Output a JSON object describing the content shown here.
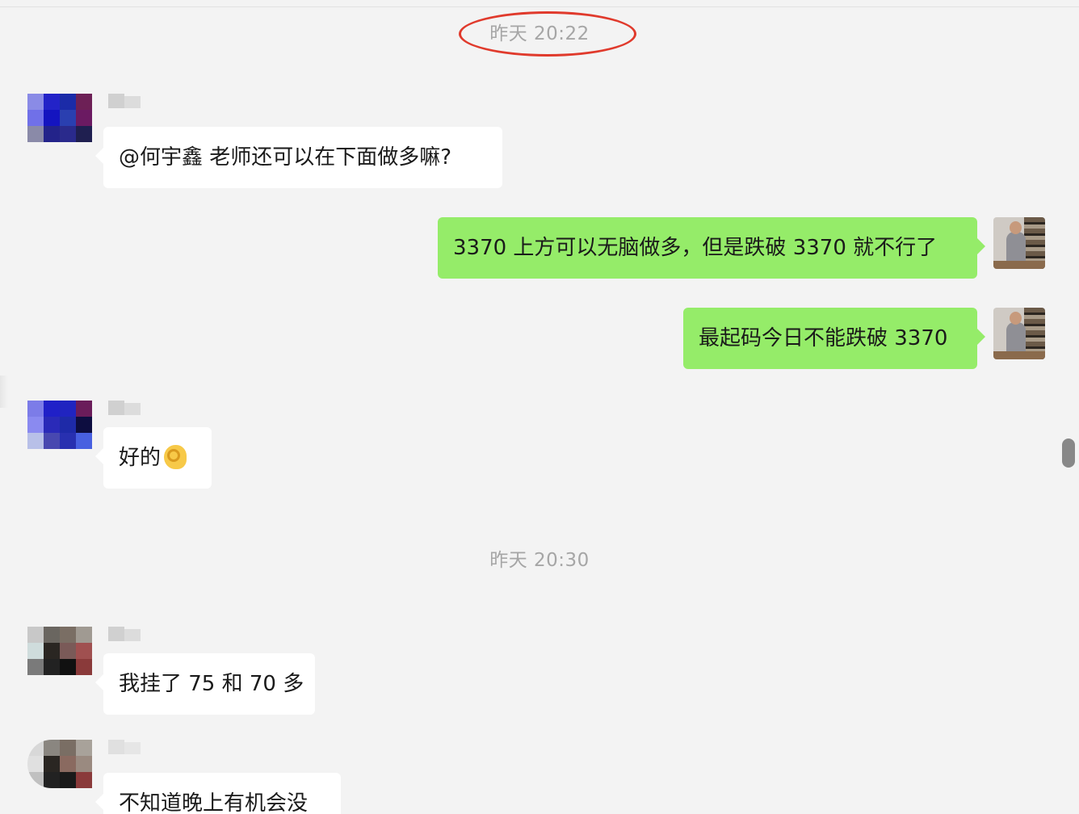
{
  "timestamps": {
    "first": "昨天 20:22",
    "second": "昨天 20:30"
  },
  "messages": {
    "m1": "@何宇鑫 老师还可以在下面做多嘛?",
    "m2": "3370 上方可以无脑做多，但是跌破 3370 就不行了",
    "m3": "最起码今日不能跌破 3370",
    "m4": "好的",
    "m5": "我挂了 75 和 70 多",
    "m6": "不知道晚上有机会没"
  },
  "colors": {
    "background": "#f3f3f3",
    "incoming_bubble": "#ffffff",
    "outgoing_bubble": "#95ec69",
    "annotation_circle": "#e03a2c",
    "timestamp_text": "#a6a6a6"
  },
  "icons": {
    "ok_emoji": "ok-hand-emoji"
  }
}
